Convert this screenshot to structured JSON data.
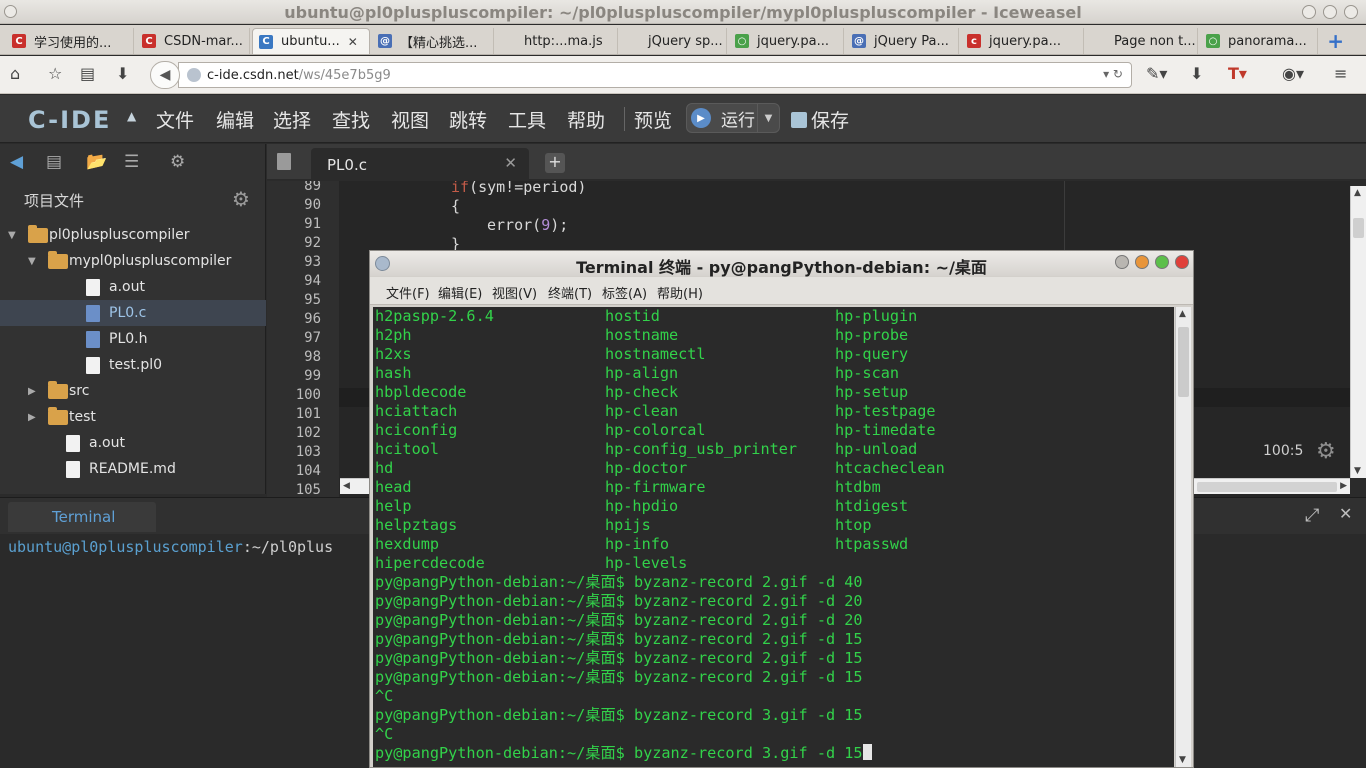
{
  "browser": {
    "title": "ubuntu@pl0pluspluscompiler: ~/pl0pluspluscompiler/mypl0pluspluscompiler - Iceweasel",
    "tabs": [
      {
        "label": "学习使用的...",
        "icon": "csdn-icon",
        "color": "#c9302c",
        "glyph": "C"
      },
      {
        "label": "CSDN-mar...",
        "icon": "csdn-icon",
        "color": "#c9302c",
        "glyph": "C"
      },
      {
        "label": "ubuntu...",
        "icon": "cide-icon",
        "color": "#3a78c2",
        "glyph": "C",
        "active": true
      },
      {
        "label": "【精心挑选...",
        "icon": "globe-icon",
        "color": "#4a6fb5",
        "glyph": "@"
      },
      {
        "label": "http:...ma.js",
        "icon": "none",
        "color": "",
        "glyph": ""
      },
      {
        "label": "jQuery sp...",
        "icon": "none",
        "color": "",
        "glyph": ""
      },
      {
        "label": "jquery.pa...",
        "icon": "spinner-icon",
        "color": "#4aa14a",
        "glyph": "○"
      },
      {
        "label": "jQuery Pa...",
        "icon": "globe-icon",
        "color": "#4a6fb5",
        "glyph": "@"
      },
      {
        "label": "jquery.pa...",
        "icon": "csdn-icon",
        "color": "#c9302c",
        "glyph": "c"
      },
      {
        "label": "Page non t...",
        "icon": "none",
        "color": "",
        "glyph": ""
      },
      {
        "label": "panorama...",
        "icon": "spinner-icon",
        "color": "#4aa14a",
        "glyph": "○"
      }
    ],
    "new_tab": "+",
    "url_host": "c-ide.csdn.net",
    "url_path": "/ws/45e7b5g9"
  },
  "ide": {
    "logo": "C-IDE",
    "menu": [
      "文件",
      "编辑",
      "选择",
      "查找",
      "视图",
      "跳转",
      "工具",
      "帮助"
    ],
    "preview": "预览",
    "run": "运行",
    "save": "保存",
    "project_title": "项目文件",
    "tree": [
      {
        "label": "pl0pluspluscompiler",
        "type": "folder",
        "level": 0,
        "arrow": "▼"
      },
      {
        "label": "mypl0pluspluscompiler",
        "type": "folder",
        "level": 1,
        "arrow": "▼"
      },
      {
        "label": "a.out",
        "type": "file",
        "level": 2,
        "arrow": ""
      },
      {
        "label": "PL0.c",
        "type": "cfile",
        "level": 2,
        "arrow": "",
        "selected": true
      },
      {
        "label": "PL0.h",
        "type": "cfile",
        "level": 2,
        "arrow": ""
      },
      {
        "label": "test.pl0",
        "type": "file",
        "level": 2,
        "arrow": ""
      },
      {
        "label": "src",
        "type": "folder",
        "level": 1,
        "arrow": "▶"
      },
      {
        "label": "test",
        "type": "folder",
        "level": 1,
        "arrow": "▶"
      },
      {
        "label": "a.out",
        "type": "file",
        "level": 1,
        "arrow": ""
      },
      {
        "label": "README.md",
        "type": "file",
        "level": 1,
        "arrow": ""
      }
    ],
    "editor_tab": "PL0.c",
    "line_numbers": [
      "89",
      "90",
      "91",
      "92",
      "93",
      "94",
      "95",
      "96",
      "97",
      "98",
      "99",
      "100",
      "101",
      "102",
      "103",
      "104",
      "105"
    ],
    "code": {
      "line89_kw": "if",
      "line89_rest": "(sym!=period)",
      "line90": "{",
      "line91_fn": "error(",
      "line91_num": "9",
      "line91_end": ");",
      "line92": "}"
    },
    "cursor_position": "100:5",
    "bottom_tab": "Terminal",
    "bottom_prompt_user": "ubuntu@pl0pluspluscompiler",
    "bottom_prompt_path": ":~/pl0plus"
  },
  "terminal": {
    "title": "Terminal 终端 - py@pangPython-debian: ~/桌面",
    "menu": [
      "文件(F)",
      "编辑(E)",
      "视图(V)",
      "终端(T)",
      "标签(A)",
      "帮助(H)"
    ],
    "columns": [
      [
        "h2paspp-2.6.4",
        "h2ph",
        "h2xs",
        "hash",
        "hbpldecode",
        "hciattach",
        "hciconfig",
        "hcitool",
        "hd",
        "head",
        "help",
        "helpztags",
        "hexdump",
        "hipercdecode"
      ],
      [
        "hostid",
        "hostname",
        "hostnamectl",
        "hp-align",
        "hp-check",
        "hp-clean",
        "hp-colorcal",
        "hp-config_usb_printer",
        "hp-doctor",
        "hp-firmware",
        "hp-hpdio",
        "hpijs",
        "hp-info",
        "hp-levels"
      ],
      [
        "hp-plugin",
        "hp-probe",
        "hp-query",
        "hp-scan",
        "hp-setup",
        "hp-testpage",
        "hp-timedate",
        "hp-unload",
        "htcacheclean",
        "htdbm",
        "htdigest",
        "htop",
        "htpasswd",
        ""
      ]
    ],
    "history": [
      "py@pangPython-debian:~/桌面$ byzanz-record 2.gif -d 40",
      "py@pangPython-debian:~/桌面$ byzanz-record 2.gif -d 20",
      "py@pangPython-debian:~/桌面$ byzanz-record 2.gif -d 20",
      "py@pangPython-debian:~/桌面$ byzanz-record 2.gif -d 15",
      "py@pangPython-debian:~/桌面$ byzanz-record 2.gif -d 15",
      "py@pangPython-debian:~/桌面$ byzanz-record 2.gif -d 15",
      "^C",
      "py@pangPython-debian:~/桌面$ byzanz-record 3.gif -d 15",
      "^C",
      "py@pangPython-debian:~/桌面$ byzanz-record 3.gif -d 15"
    ]
  },
  "colors": {
    "terminal_text": "#32d24a",
    "ide_background": "#2b2b2b",
    "prompt_blue": "#5aa0d0"
  }
}
